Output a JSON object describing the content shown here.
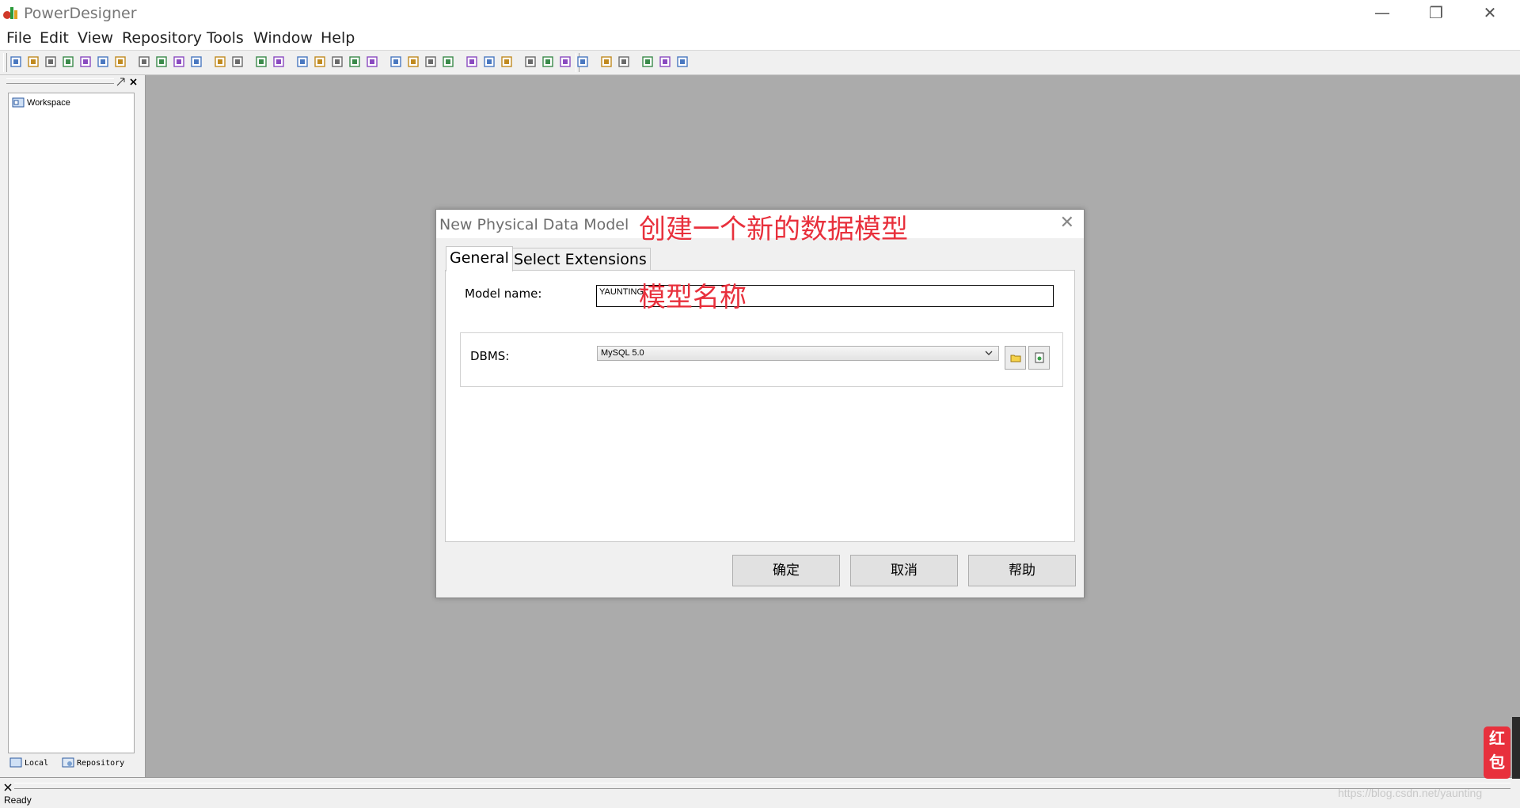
{
  "app": {
    "title": "PowerDesigner"
  },
  "window_controls": {
    "minimize": "—",
    "restore": "❐",
    "close": "✕"
  },
  "menu": [
    "File",
    "Edit",
    "View",
    "Repository",
    "Tools",
    "Window",
    "Help"
  ],
  "toolbar_icons": [
    "new-icon",
    "open-model-icon",
    "open-icon",
    "save-icon",
    "save-all-icon",
    "print-preview-icon",
    "print-icon",
    "cut-icon",
    "copy-icon",
    "paste-icon",
    "delete-icon",
    "undo-icon",
    "redo-icon",
    "properties-icon",
    "check-model-icon",
    "browse-icon",
    "package-icon",
    "link-icon",
    "move-icon",
    "symbol-icon",
    "group-icon",
    "line-icon",
    "bend-icon",
    "text-icon",
    "import-icon",
    "export-icon",
    "forward-icon",
    "align-left-icon",
    "align-top-icon",
    "bring-front-icon",
    "send-back-icon",
    "zoom-in-icon",
    "zoom-out-icon",
    "browser-icon",
    "output-icon",
    "result-icon"
  ],
  "browser": {
    "tree_root": "Workspace",
    "tabs": [
      "Local",
      "Repository"
    ]
  },
  "status": {
    "text": "Ready"
  },
  "watermark": "https://blog.csdn.net/yaunting",
  "dialog": {
    "title": "New Physical Data Model",
    "title_annotation": "创建一个新的数据模型",
    "close_label": "✕",
    "tabs": [
      "General",
      "Select Extensions"
    ],
    "model_name_label": "Model name:",
    "model_name_value": "YAUNTING",
    "model_name_annotation": "模型名称",
    "dbms_label": "DBMS:",
    "dbms_value": "MySQL 5.0",
    "buttons": {
      "ok": "确定",
      "cancel": "取消",
      "help": "帮助"
    }
  },
  "hongbao": "红包",
  "colors": {
    "workspace_bg": "#ababab",
    "annotation": "#e8303c"
  }
}
